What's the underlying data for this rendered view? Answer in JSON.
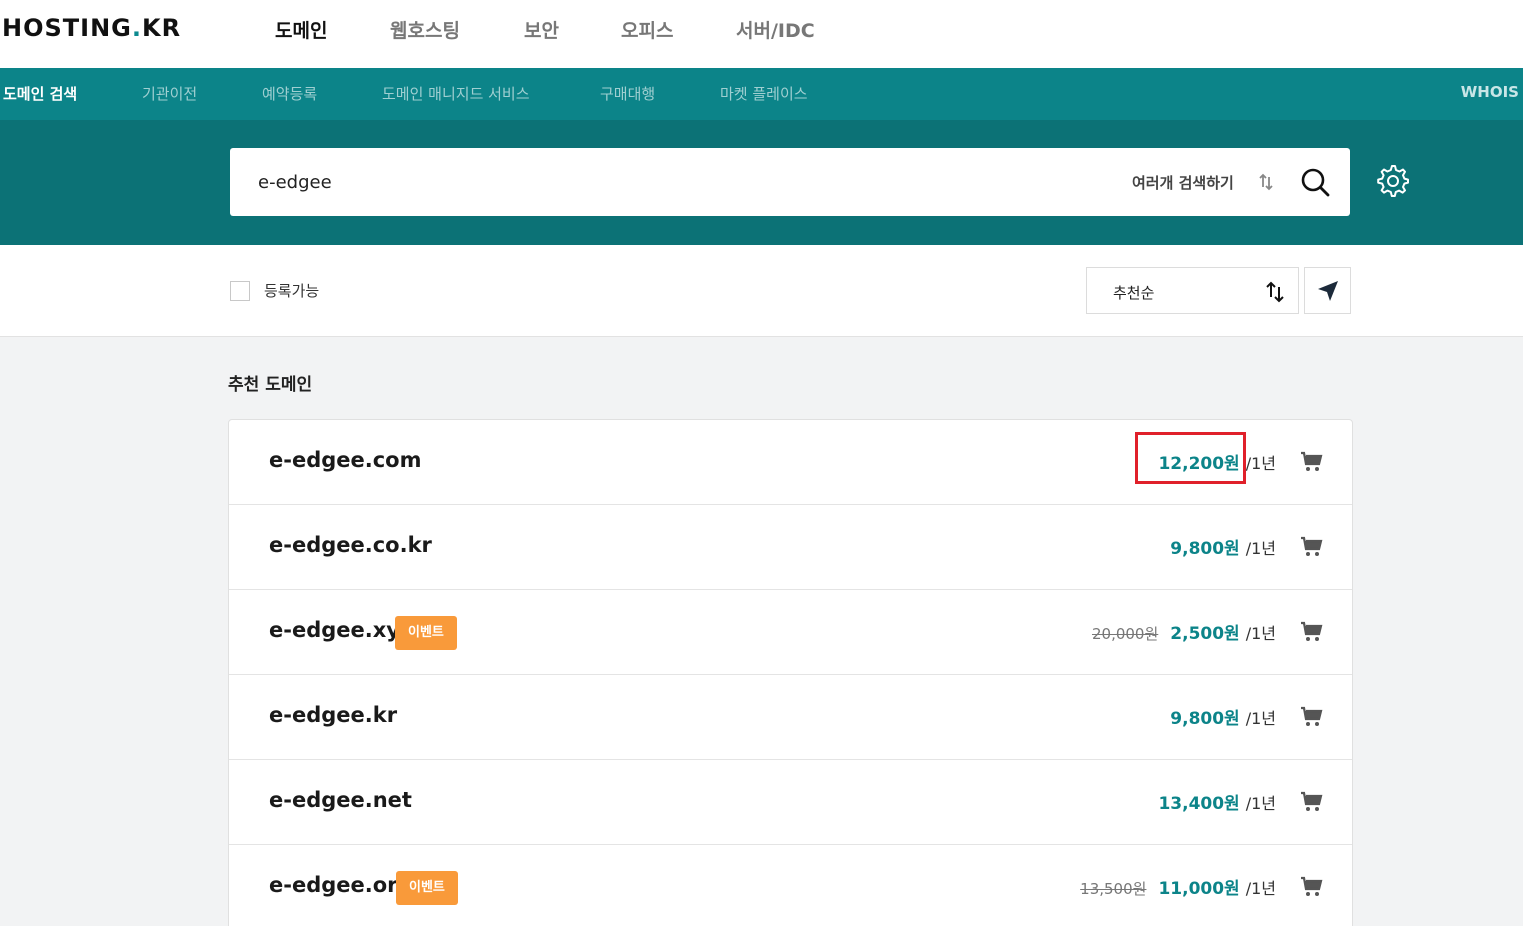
{
  "header": {
    "logo_main": "HOSTING",
    "logo_dot": ".",
    "logo_tld": "KR",
    "nav": [
      "도메인",
      "웹호스팅",
      "보안",
      "오피스",
      "서버/IDC"
    ]
  },
  "subnav": {
    "items": [
      "도메인 검색",
      "기관이전",
      "예약등록",
      "도메인 매니지드 서비스",
      "구매대행",
      "마켓 플레이스"
    ],
    "whois": "WHOIS"
  },
  "search": {
    "value": "e-edgee",
    "multi_label": "여러개 검색하기"
  },
  "filter": {
    "available_label": "등록가능",
    "sort_label": "추천순"
  },
  "results": {
    "title": "추천 도메인",
    "rows": [
      {
        "domain": "e-edgee.com",
        "badge": "",
        "old_price": "",
        "price": "12,200원",
        "period": "/1년"
      },
      {
        "domain": "e-edgee.co.kr",
        "badge": "",
        "old_price": "",
        "price": "9,800원",
        "period": "/1년"
      },
      {
        "domain": "e-edgee.xyz",
        "badge": "이벤트",
        "old_price": "20,000원",
        "price": "2,500원",
        "period": "/1년"
      },
      {
        "domain": "e-edgee.kr",
        "badge": "",
        "old_price": "",
        "price": "9,800원",
        "period": "/1년"
      },
      {
        "domain": "e-edgee.net",
        "badge": "",
        "old_price": "",
        "price": "13,400원",
        "period": "/1년"
      },
      {
        "domain": "e-edgee.org",
        "badge": "이벤트",
        "old_price": "13,500원",
        "price": "11,000원",
        "period": "/1년"
      }
    ]
  },
  "colors": {
    "brand_teal": "#0c8489",
    "search_band": "#0c7276",
    "event_badge": "#f99a3a",
    "highlight": "#e0202a"
  },
  "icons": [
    "search-icon",
    "settings-gear-icon",
    "sort-arrows-icon",
    "send-icon",
    "cart-icon"
  ]
}
